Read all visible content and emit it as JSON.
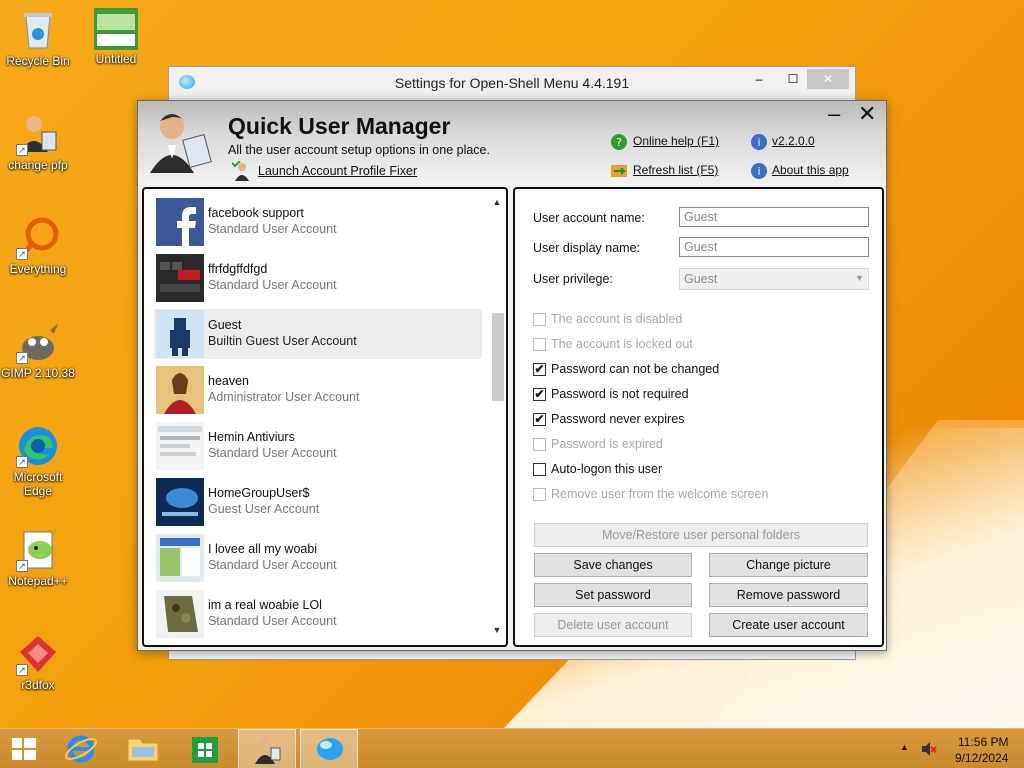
{
  "desktop": {
    "icons": [
      {
        "label": "Recycle Bin"
      },
      {
        "label": "Untitled"
      },
      {
        "label": "change pfp"
      },
      {
        "label": "Everything"
      },
      {
        "label": "GIMP 2.10.38"
      },
      {
        "label": "Microsoft Edge"
      },
      {
        "label": "Notepad++"
      },
      {
        "label": "r3dfox"
      }
    ]
  },
  "bg_window": {
    "title": "Settings for Open-Shell Menu 4.4.191",
    "minimize": "–",
    "maximize": "☐",
    "close": "✕"
  },
  "app": {
    "title": "Quick User Manager",
    "subtitle": "All the user account setup options in one place.",
    "launch_link": "Launch Account Profile Fixer",
    "online_help": "Online help (F1)",
    "version": "v2.2.0.0",
    "refresh": "Refresh list (F5)",
    "about": "About this app",
    "minimize": "–",
    "close": "✕"
  },
  "users": [
    {
      "name": "facebook support",
      "type": "Standard User Account"
    },
    {
      "name": "ffrfdgffdfgd",
      "type": "Standard User Account"
    },
    {
      "name": "Guest",
      "type": "Builtin Guest User Account"
    },
    {
      "name": "heaven",
      "type": "Administrator User Account"
    },
    {
      "name": "Hemin Antiviurs",
      "type": "Standard User Account"
    },
    {
      "name": "HomeGroupUser$",
      "type": "Guest User Account"
    },
    {
      "name": "I lovee all my woabi",
      "type": "Standard User Account"
    },
    {
      "name": "im a real woabie LOl",
      "type": "Standard User Account"
    }
  ],
  "details": {
    "account_name_label": "User account name:",
    "account_name_value": "Guest",
    "display_name_label": "User display name:",
    "display_name_value": "Guest",
    "privilege_label": "User privilege:",
    "privilege_value": "Guest",
    "checkboxes": [
      {
        "label": "The account is disabled",
        "checked": false,
        "enabled": false
      },
      {
        "label": "The account is locked out",
        "checked": false,
        "enabled": false
      },
      {
        "label": "Password can not be changed",
        "checked": true,
        "enabled": true
      },
      {
        "label": "Password is not required",
        "checked": true,
        "enabled": true
      },
      {
        "label": "Password never expires",
        "checked": true,
        "enabled": true
      },
      {
        "label": "Password is expired",
        "checked": false,
        "enabled": false
      },
      {
        "label": "Auto-logon this user",
        "checked": false,
        "enabled": true
      },
      {
        "label": "Remove user from the welcome screen",
        "checked": false,
        "enabled": false
      }
    ],
    "move_restore": "Move/Restore user personal folders",
    "save_changes": "Save changes",
    "change_picture": "Change picture",
    "set_password": "Set password",
    "remove_password": "Remove password",
    "delete_user": "Delete user account",
    "create_user": "Create user account",
    "check_mark": "✔"
  },
  "taskbar": {
    "time": "11:56 PM",
    "date": "9/12/2024",
    "tray_arrow": "▲"
  }
}
